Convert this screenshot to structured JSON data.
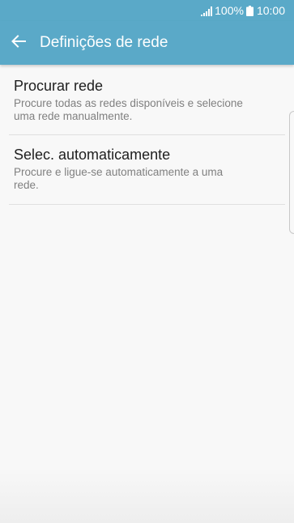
{
  "status_bar": {
    "battery": "100%",
    "time": "10:00"
  },
  "icons": {
    "signal": "signal-icon",
    "battery": "battery-icon",
    "back": "back-arrow-icon"
  },
  "header": {
    "title": "Definições de rede"
  },
  "list": {
    "items": [
      {
        "title": "Procurar rede",
        "summary": "Procure todas as redes disponíveis e selecione uma rede manualmente."
      },
      {
        "title": "Selec. automaticamente",
        "summary": "Procure e ligue-se automaticamente a uma rede."
      }
    ]
  },
  "colors": {
    "accent": "#5aa9c8",
    "background": "#f8f8f8",
    "title_text": "#202020",
    "summary_text": "#808080",
    "divider": "#e0e0e0"
  }
}
